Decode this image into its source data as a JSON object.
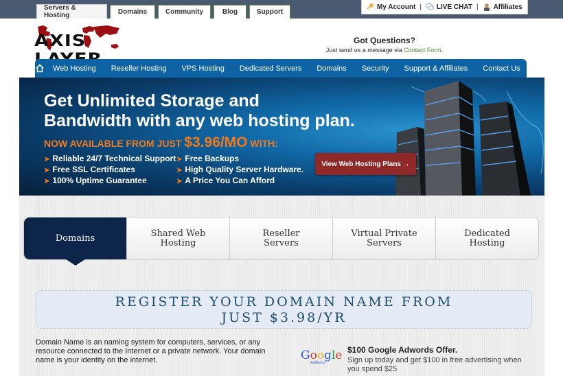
{
  "top_tabs": [
    {
      "label": "Servers & Hosting",
      "active": true
    },
    {
      "label": "Domains",
      "active": false
    },
    {
      "label": "Community",
      "active": false
    },
    {
      "label": "Blog",
      "active": false
    },
    {
      "label": "Support",
      "active": false
    }
  ],
  "account_bar": {
    "my_account": "My Account",
    "live_chat": "LIVE CHAT",
    "affiliates": "Affiliates",
    "separator": "|"
  },
  "logo": {
    "text": "AXIS LAYER"
  },
  "questions": {
    "title": "Got Questions?",
    "subtitle": "Just send us a message via",
    "link": "Contact Form",
    "suffix": "."
  },
  "main_nav": {
    "home_icon": "home-icon",
    "items": [
      "Web Hosting",
      "Reseller Hosting",
      "VPS Hosting",
      "Dedicated Servers",
      "Domains",
      "Security",
      "Support & Affiliates",
      "Contact Us"
    ]
  },
  "banner": {
    "headline_1": "Get Unlimited Storage and",
    "headline_2": "Bandwidth with any web hosting plan.",
    "avail_prefix": "NOW AVAILABLE FROM JUST ",
    "avail_price": "$3.96/MO",
    "avail_suffix": " WITH:",
    "features_col1": [
      "Reliable 24/7 Technical Support",
      "Free SSL Certificates",
      "100% Uptime Guarantee"
    ],
    "features_col2": [
      "Free Backups",
      "High Quality Server Hardware.",
      "A Price You Can Afford"
    ],
    "cta": "View Web Hosting Plans →",
    "colors": {
      "accent": "#f07a1e",
      "cta_bg": "#8f2828"
    }
  },
  "product_tabs": [
    {
      "line1": "Domains",
      "line2": "",
      "active": true
    },
    {
      "line1": "Shared Web",
      "line2": "Hosting",
      "active": false
    },
    {
      "line1": "Reseller",
      "line2": "Servers",
      "active": false
    },
    {
      "line1": "Virtual Private",
      "line2": "Servers",
      "active": false
    },
    {
      "line1": "Dedicated",
      "line2": "Hosting",
      "active": false
    }
  ],
  "register": {
    "line1": "REGISTER YOUR DOMAIN NAME FROM",
    "line2": "JUST $3.98/YR"
  },
  "description": "Domain Name is an naming system for computers, services, or any resource connected to the Internet or a private network. Your domain name is your identity on the internet.",
  "google_offer": {
    "logo_text": "Google",
    "logo_sub": "AdWords",
    "title": "$100 Google Adwords Offer.",
    "text": "Sign up today and get $100 in free advertising when you spend $25"
  },
  "colors": {
    "topbar": "#4a5a70",
    "nav": "#0e63a4",
    "active_tab": "#0b2447",
    "link_green": "#4a8a2a"
  }
}
